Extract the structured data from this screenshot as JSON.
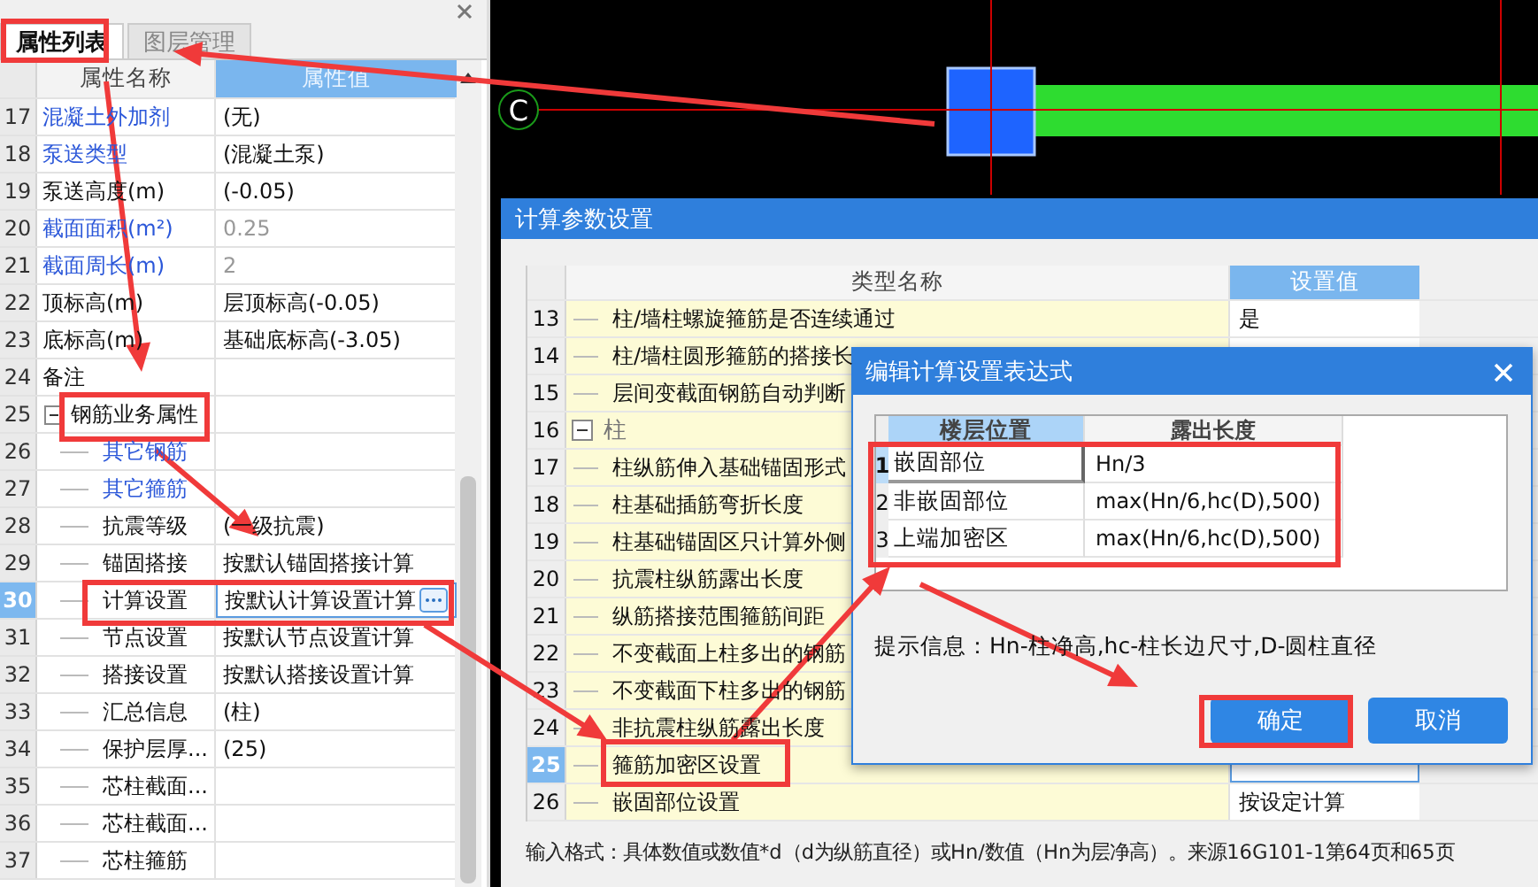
{
  "properties": {
    "tabs": [
      {
        "label": "属性列表",
        "selected": true
      },
      {
        "label": "图层管理",
        "selected": false
      }
    ],
    "columns": [
      "属性名称",
      "属性值"
    ],
    "rows": [
      {
        "num": "17",
        "kind": "field",
        "name": "混凝土外加剂",
        "value": "(无)",
        "linked": true,
        "disabled": false,
        "selected": false
      },
      {
        "num": "18",
        "kind": "field",
        "name": "泵送类型",
        "value": "(混凝土泵)",
        "linked": true,
        "disabled": false,
        "selected": false
      },
      {
        "num": "19",
        "kind": "field",
        "name": "泵送高度(m)",
        "value": "(-0.05)",
        "linked": false,
        "disabled": false,
        "selected": false
      },
      {
        "num": "20",
        "kind": "field",
        "name": "截面面积(m²)",
        "value": "0.25",
        "linked": true,
        "disabled": true,
        "selected": false
      },
      {
        "num": "21",
        "kind": "field",
        "name": "截面周长(m)",
        "value": "2",
        "linked": true,
        "disabled": true,
        "selected": false
      },
      {
        "num": "22",
        "kind": "field",
        "name": "顶标高(m)",
        "value": "层顶标高(-0.05)",
        "linked": false,
        "disabled": false,
        "selected": false
      },
      {
        "num": "23",
        "kind": "field",
        "name": "底标高(m)",
        "value": "基础底标高(-3.05)",
        "linked": false,
        "disabled": false,
        "selected": false
      },
      {
        "num": "24",
        "kind": "field",
        "name": "备注",
        "linked": false,
        "selected": false
      },
      {
        "num": "25",
        "kind": "group",
        "name": "钢筋业务属性",
        "expanded": true,
        "selected": false
      },
      {
        "num": "26",
        "kind": "child",
        "name": "其它钢筋",
        "linked": true,
        "selected": false
      },
      {
        "num": "27",
        "kind": "child",
        "name": "其它箍筋",
        "linked": true,
        "selected": false
      },
      {
        "num": "28",
        "kind": "child",
        "name": "抗震等级",
        "value": "(一级抗震)",
        "linked": false,
        "disabled": false,
        "selected": false
      },
      {
        "num": "29",
        "kind": "child",
        "name": "锚固搭接",
        "value": "按默认锚固搭接计算",
        "linked": false,
        "disabled": false,
        "selected": false
      },
      {
        "num": "30",
        "kind": "child",
        "name": "计算设置",
        "value": "按默认计算设置计算",
        "linked": false,
        "disabled": false,
        "selected": true
      },
      {
        "num": "31",
        "kind": "child",
        "name": "节点设置",
        "value": "按默认节点设置计算",
        "linked": false,
        "disabled": false,
        "selected": false
      },
      {
        "num": "32",
        "kind": "child",
        "name": "搭接设置",
        "value": "按默认搭接设置计算",
        "linked": false,
        "disabled": false,
        "selected": false
      },
      {
        "num": "33",
        "kind": "child",
        "name": "汇总信息",
        "value": "(柱)",
        "linked": false,
        "disabled": false,
        "selected": false
      },
      {
        "num": "34",
        "kind": "child",
        "name": "保护层厚...",
        "value": "(25)",
        "linked": false,
        "disabled": false,
        "selected": false
      },
      {
        "num": "35",
        "kind": "child",
        "name": "芯柱截面...",
        "linked": false,
        "selected": false
      },
      {
        "num": "36",
        "kind": "child",
        "name": "芯柱截面...",
        "linked": false,
        "selected": false
      },
      {
        "num": "37",
        "kind": "child",
        "name": "芯柱箍筋",
        "linked": false,
        "selected": false
      }
    ]
  },
  "canvas": {
    "axis_label": "C"
  },
  "calc_dialog": {
    "title": "计算参数设置",
    "columns": [
      "类型名称",
      "设置值"
    ],
    "rows": [
      {
        "num": "13",
        "kind": "child",
        "name": "柱/墙柱螺旋箍筋是否连续通过",
        "value": "是",
        "selected": false
      },
      {
        "num": "14",
        "kind": "child",
        "name": "柱/墙柱圆形箍筋的搭接长",
        "selected": false
      },
      {
        "num": "15",
        "kind": "child",
        "name": "层间变截面钢筋自动判断",
        "selected": false
      },
      {
        "num": "16",
        "kind": "group",
        "name": "柱",
        "expanded": true,
        "selected": false
      },
      {
        "num": "17",
        "kind": "child",
        "name": "柱纵筋伸入基础锚固形式",
        "selected": false
      },
      {
        "num": "18",
        "kind": "child",
        "name": "柱基础插筋弯折长度",
        "selected": false
      },
      {
        "num": "19",
        "kind": "child",
        "name": "柱基础锚固区只计算外侧",
        "selected": false
      },
      {
        "num": "20",
        "kind": "child",
        "name": "抗震柱纵筋露出长度",
        "selected": false
      },
      {
        "num": "21",
        "kind": "child",
        "name": "纵筋搭接范围箍筋间距",
        "selected": false
      },
      {
        "num": "22",
        "kind": "child",
        "name": "不变截面上柱多出的钢筋",
        "selected": false
      },
      {
        "num": "23",
        "kind": "child",
        "name": "不变截面下柱多出的钢筋",
        "selected": false
      },
      {
        "num": "24",
        "kind": "child",
        "name": "非抗震柱纵筋露出长度",
        "selected": false
      },
      {
        "num": "25",
        "kind": "child",
        "name": "箍筋加密区设置",
        "selected": true
      },
      {
        "num": "26",
        "kind": "child",
        "name": "嵌固部位设置",
        "value": "按设定计算",
        "selected": false
      }
    ],
    "footer": "输入格式：具体数值或数值*d（d为纵筋直径）或Hn/数值（Hn为层净高）。来源16G101-1第64页和65页"
  },
  "edit_dialog": {
    "title": "编辑计算设置表达式",
    "columns": [
      "楼层位置",
      "露出长度"
    ],
    "rows": [
      {
        "num": "1",
        "position": "嵌固部位",
        "length": "Hn/3",
        "selected": true
      },
      {
        "num": "2",
        "position": "非嵌固部位",
        "length": "max(Hn/6,hc(D),500)",
        "selected": false
      },
      {
        "num": "3",
        "position": "上端加密区",
        "length": "max(Hn/6,hc(D),500)",
        "selected": false
      }
    ],
    "hint": "提示信息：Hn-柱净高,hc-柱长边尺寸,D-圆柱直径",
    "buttons": [
      "确定",
      "取消"
    ]
  }
}
